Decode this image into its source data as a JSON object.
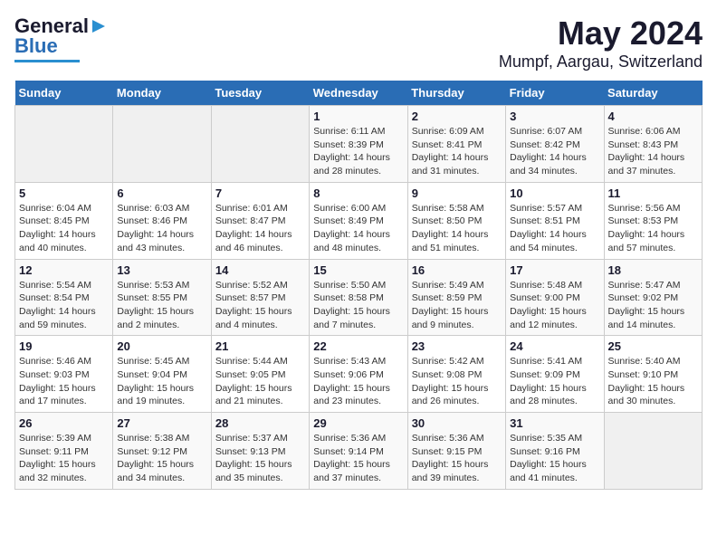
{
  "logo": {
    "line1": "General",
    "line2": "Blue"
  },
  "title": "May 2024",
  "subtitle": "Mumpf, Aargau, Switzerland",
  "days_of_week": [
    "Sunday",
    "Monday",
    "Tuesday",
    "Wednesday",
    "Thursday",
    "Friday",
    "Saturday"
  ],
  "weeks": [
    [
      {
        "day": "",
        "info": ""
      },
      {
        "day": "",
        "info": ""
      },
      {
        "day": "",
        "info": ""
      },
      {
        "day": "1",
        "info": "Sunrise: 6:11 AM\nSunset: 8:39 PM\nDaylight: 14 hours\nand 28 minutes."
      },
      {
        "day": "2",
        "info": "Sunrise: 6:09 AM\nSunset: 8:41 PM\nDaylight: 14 hours\nand 31 minutes."
      },
      {
        "day": "3",
        "info": "Sunrise: 6:07 AM\nSunset: 8:42 PM\nDaylight: 14 hours\nand 34 minutes."
      },
      {
        "day": "4",
        "info": "Sunrise: 6:06 AM\nSunset: 8:43 PM\nDaylight: 14 hours\nand 37 minutes."
      }
    ],
    [
      {
        "day": "5",
        "info": "Sunrise: 6:04 AM\nSunset: 8:45 PM\nDaylight: 14 hours\nand 40 minutes."
      },
      {
        "day": "6",
        "info": "Sunrise: 6:03 AM\nSunset: 8:46 PM\nDaylight: 14 hours\nand 43 minutes."
      },
      {
        "day": "7",
        "info": "Sunrise: 6:01 AM\nSunset: 8:47 PM\nDaylight: 14 hours\nand 46 minutes."
      },
      {
        "day": "8",
        "info": "Sunrise: 6:00 AM\nSunset: 8:49 PM\nDaylight: 14 hours\nand 48 minutes."
      },
      {
        "day": "9",
        "info": "Sunrise: 5:58 AM\nSunset: 8:50 PM\nDaylight: 14 hours\nand 51 minutes."
      },
      {
        "day": "10",
        "info": "Sunrise: 5:57 AM\nSunset: 8:51 PM\nDaylight: 14 hours\nand 54 minutes."
      },
      {
        "day": "11",
        "info": "Sunrise: 5:56 AM\nSunset: 8:53 PM\nDaylight: 14 hours\nand 57 minutes."
      }
    ],
    [
      {
        "day": "12",
        "info": "Sunrise: 5:54 AM\nSunset: 8:54 PM\nDaylight: 14 hours\nand 59 minutes."
      },
      {
        "day": "13",
        "info": "Sunrise: 5:53 AM\nSunset: 8:55 PM\nDaylight: 15 hours\nand 2 minutes."
      },
      {
        "day": "14",
        "info": "Sunrise: 5:52 AM\nSunset: 8:57 PM\nDaylight: 15 hours\nand 4 minutes."
      },
      {
        "day": "15",
        "info": "Sunrise: 5:50 AM\nSunset: 8:58 PM\nDaylight: 15 hours\nand 7 minutes."
      },
      {
        "day": "16",
        "info": "Sunrise: 5:49 AM\nSunset: 8:59 PM\nDaylight: 15 hours\nand 9 minutes."
      },
      {
        "day": "17",
        "info": "Sunrise: 5:48 AM\nSunset: 9:00 PM\nDaylight: 15 hours\nand 12 minutes."
      },
      {
        "day": "18",
        "info": "Sunrise: 5:47 AM\nSunset: 9:02 PM\nDaylight: 15 hours\nand 14 minutes."
      }
    ],
    [
      {
        "day": "19",
        "info": "Sunrise: 5:46 AM\nSunset: 9:03 PM\nDaylight: 15 hours\nand 17 minutes."
      },
      {
        "day": "20",
        "info": "Sunrise: 5:45 AM\nSunset: 9:04 PM\nDaylight: 15 hours\nand 19 minutes."
      },
      {
        "day": "21",
        "info": "Sunrise: 5:44 AM\nSunset: 9:05 PM\nDaylight: 15 hours\nand 21 minutes."
      },
      {
        "day": "22",
        "info": "Sunrise: 5:43 AM\nSunset: 9:06 PM\nDaylight: 15 hours\nand 23 minutes."
      },
      {
        "day": "23",
        "info": "Sunrise: 5:42 AM\nSunset: 9:08 PM\nDaylight: 15 hours\nand 26 minutes."
      },
      {
        "day": "24",
        "info": "Sunrise: 5:41 AM\nSunset: 9:09 PM\nDaylight: 15 hours\nand 28 minutes."
      },
      {
        "day": "25",
        "info": "Sunrise: 5:40 AM\nSunset: 9:10 PM\nDaylight: 15 hours\nand 30 minutes."
      }
    ],
    [
      {
        "day": "26",
        "info": "Sunrise: 5:39 AM\nSunset: 9:11 PM\nDaylight: 15 hours\nand 32 minutes."
      },
      {
        "day": "27",
        "info": "Sunrise: 5:38 AM\nSunset: 9:12 PM\nDaylight: 15 hours\nand 34 minutes."
      },
      {
        "day": "28",
        "info": "Sunrise: 5:37 AM\nSunset: 9:13 PM\nDaylight: 15 hours\nand 35 minutes."
      },
      {
        "day": "29",
        "info": "Sunrise: 5:36 AM\nSunset: 9:14 PM\nDaylight: 15 hours\nand 37 minutes."
      },
      {
        "day": "30",
        "info": "Sunrise: 5:36 AM\nSunset: 9:15 PM\nDaylight: 15 hours\nand 39 minutes."
      },
      {
        "day": "31",
        "info": "Sunrise: 5:35 AM\nSunset: 9:16 PM\nDaylight: 15 hours\nand 41 minutes."
      },
      {
        "day": "",
        "info": ""
      }
    ]
  ]
}
